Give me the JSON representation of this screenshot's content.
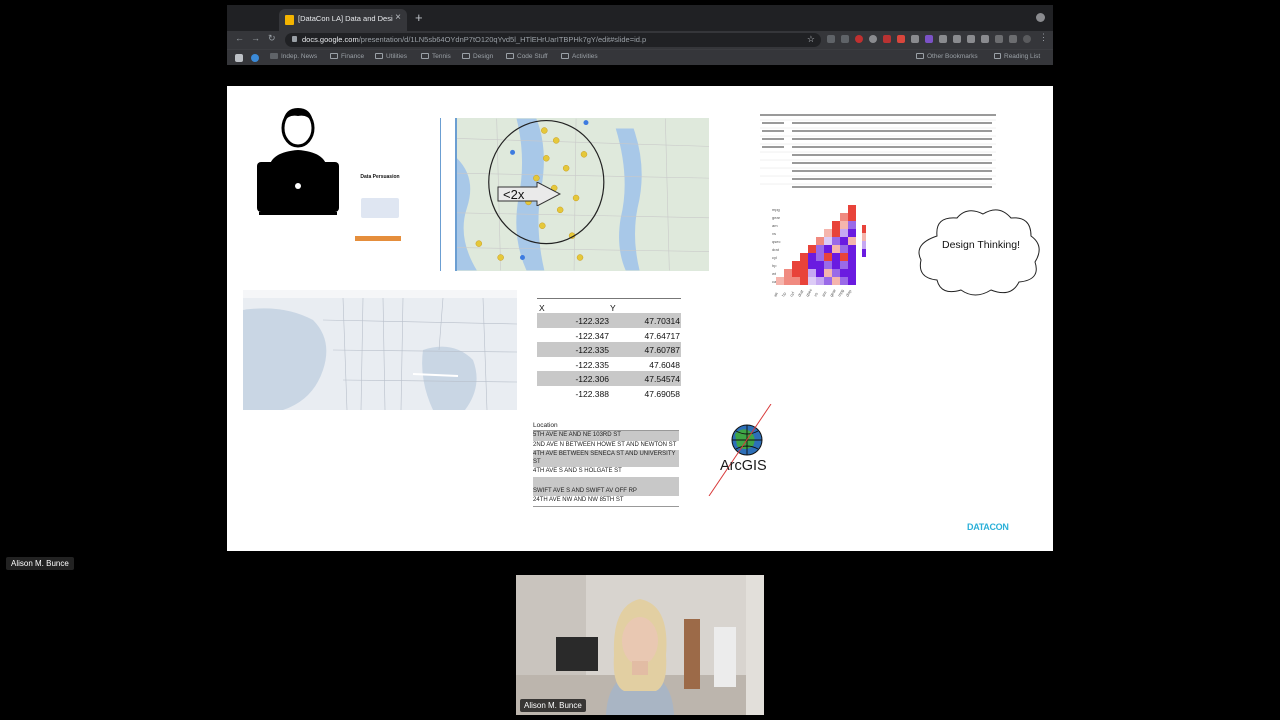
{
  "browser": {
    "tab_title": "[DataCon LA] Data and Design",
    "tab_close": "×",
    "new_tab": "+",
    "url_host": "docs.google.com",
    "url_path": "/presentation/d/1LN5sb64OYdnP7tO120qYvd5l_HTlEHrUarITBPHk7gY/edit#slide=id.p",
    "bookmarks": [
      {
        "label": "Indep. News",
        "folder": false
      },
      {
        "label": "Finance",
        "folder": true
      },
      {
        "label": "Utilities",
        "folder": true
      },
      {
        "label": "Tennis",
        "folder": true
      },
      {
        "label": "Design",
        "folder": true
      },
      {
        "label": "Code Stuff",
        "folder": true
      },
      {
        "label": "Activities",
        "folder": true
      }
    ],
    "other_bookmarks": "Other Bookmarks",
    "reading_list": "Reading List"
  },
  "slide": {
    "mini_doc_title": "Data Persuasion",
    "callout_text": "<2x",
    "cloud_text": "Design Thinking!",
    "xy_table": {
      "headers": [
        "X",
        "Y"
      ],
      "rows": [
        [
          "-122.323",
          "47.70314"
        ],
        [
          "-122.347",
          "47.64717"
        ],
        [
          "-122.335",
          "47.60787"
        ],
        [
          "-122.335",
          "47.6048"
        ],
        [
          "-122.306",
          "47.54574"
        ],
        [
          "-122.388",
          "47.69058"
        ]
      ]
    },
    "location_table": {
      "header": "Location",
      "rows": [
        "5TH AVE NE AND NE 103RD ST",
        "2ND AVE N BETWEEN HOWE ST AND NEWTON ST",
        "4TH AVE BETWEEN SENECA ST AND UNIVERSITY ST",
        "4TH AVE S AND S HOLGATE ST",
        "",
        "SWIFT AVE S AND SWIFT AV OFF RP",
        "24TH AVE NW AND NW 85TH ST"
      ]
    },
    "arcgis_label": "ArcGIS",
    "datacon_logo": "DATACON"
  },
  "participants": {
    "left_name": "Alison M. Bunce",
    "video_name": "Alison M. Bunce"
  },
  "colors": {
    "chrome_dark": "#202124",
    "chrome_mid": "#35363a",
    "slide_bg": "#ffffff",
    "heat_red": "#e8433a",
    "heat_purple": "#6a1be0",
    "datacon_blue": "#2bb0d8"
  }
}
